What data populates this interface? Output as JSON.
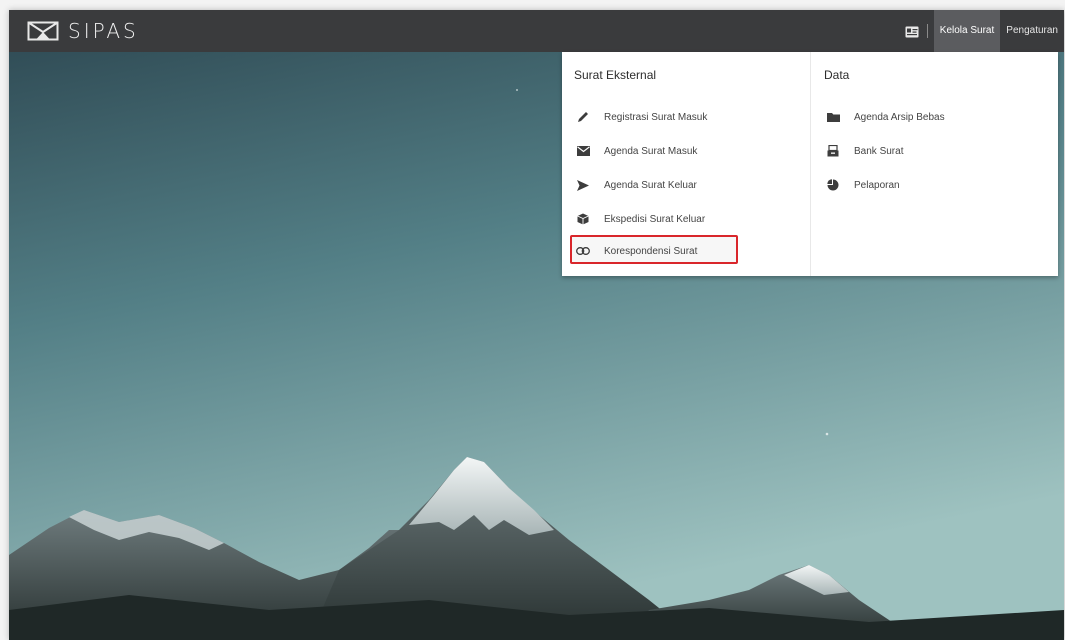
{
  "app": {
    "logo_text": "SIPAS"
  },
  "navbar": {
    "items": [
      {
        "label": "Kelola Surat",
        "active": true
      },
      {
        "label": "Pengaturan",
        "active": false
      }
    ]
  },
  "menu": {
    "left": {
      "title": "Surat Eksternal",
      "items": [
        {
          "label": "Registrasi Surat Masuk",
          "icon": "pencil-icon"
        },
        {
          "label": "Agenda Surat Masuk",
          "icon": "envelope-icon"
        },
        {
          "label": "Agenda Surat Keluar",
          "icon": "send-icon"
        },
        {
          "label": "Ekspedisi Surat Keluar",
          "icon": "cube-icon"
        },
        {
          "label": "Korespondensi Surat",
          "icon": "link-icon",
          "highlighted": true
        }
      ]
    },
    "right": {
      "title": "Data",
      "items": [
        {
          "label": "Agenda Arsip Bebas",
          "icon": "folder-icon"
        },
        {
          "label": "Bank Surat",
          "icon": "inbox-icon"
        },
        {
          "label": "Pelaporan",
          "icon": "pie-chart-icon"
        }
      ]
    }
  },
  "colors": {
    "navbar": "#3a3b3d",
    "nav_active": "#5b5c5f",
    "highlight_border": "#d9262b",
    "sky_top": "#2e4c55",
    "sky_bottom": "#8cb3b3"
  }
}
